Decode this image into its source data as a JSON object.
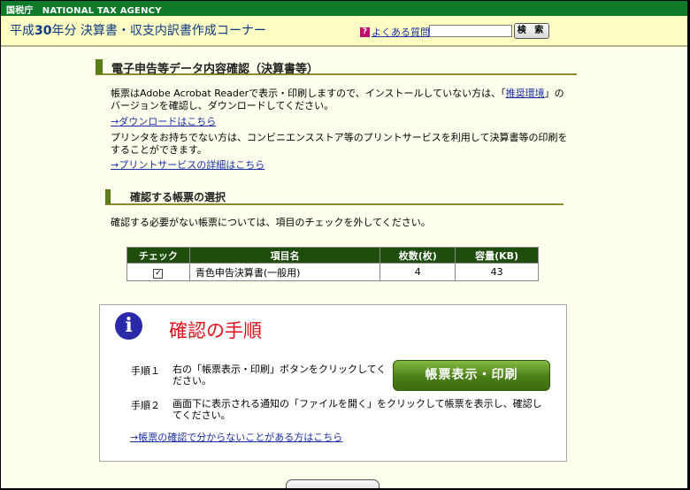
{
  "agency": "国税庁　NATIONAL TAX AGENCY",
  "header": {
    "title_prefix": "平成",
    "title_year": "30",
    "title_suffix": "年分 決算書・収支内訳書作成コーナー",
    "faq_icon": "?",
    "faq_label": "よくある質問",
    "search_value": "",
    "search_button": "検 索"
  },
  "section1": {
    "heading": "電子申告等データ内容確認（決算書等）",
    "para1_before": "帳票はAdobe Acrobat Readerで表示・印刷しますので、インストールしていない方は、「",
    "para1_link": "推奨環境",
    "para1_after": "」のバージョンを確認し、ダウンロードしてください。",
    "download_link": "→ダウンロードはこちら",
    "para2": "プリンタをお持ちでない方は、コンビニエンスストア等のプリントサービスを利用して決算書等の印刷をすることができます。",
    "print_service_link": "→プリントサービスの詳細はこちら"
  },
  "section2": {
    "heading": "確認する帳票の選択",
    "instruction": "確認する必要がない帳票については、項目のチェックを外してください。",
    "table": {
      "headers": [
        "チェック",
        "項目名",
        "枚数(枚)",
        "容量(KB)"
      ],
      "rows": [
        {
          "checked": true,
          "check_mark": "✓",
          "name": "青色申告決算書(一般用)",
          "pages": "4",
          "size": "43"
        }
      ]
    }
  },
  "procedure": {
    "icon": "i",
    "title": "確認の手順",
    "step1_label": "手順１",
    "step1_text": "右の「帳票表示・印刷」ボタンをクリックしてください。",
    "step2_label": "手順２",
    "step2_text": "画面下に表示される通知の「ファイルを開く」をクリックして帳票を表示し、確認してください。",
    "print_button": "帳票表示・印刷",
    "help_link": "→帳票の確認で分からないことがある方はこちら"
  },
  "colors": {
    "top_bar": "#0e7a2a",
    "header_bg": "#ffffc4",
    "page_bg": "#ffffee",
    "section_accent": "#5b7d18",
    "table_header": "#1e4d0c",
    "procedure_title": "#e0101a",
    "print_button": "#4a7d17",
    "link": "#1a2fa6"
  }
}
